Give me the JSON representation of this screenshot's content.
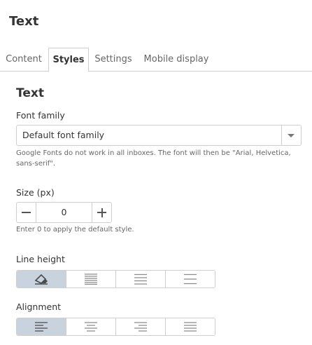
{
  "panel": {
    "title": "Text"
  },
  "tabs": [
    {
      "label": "Content",
      "active": false
    },
    {
      "label": "Styles",
      "active": true
    },
    {
      "label": "Settings",
      "active": false
    },
    {
      "label": "Mobile display",
      "active": false
    }
  ],
  "section": {
    "title": "Text"
  },
  "font_family": {
    "label": "Font family",
    "value": "Default font family",
    "help": "Google Fonts do not work in all inboxes. The font will then be \"Arial, Helvetica, sans-serif\"."
  },
  "size": {
    "label": "Size (px)",
    "value": "0",
    "help": "Enter 0 to apply the default style."
  },
  "line_height": {
    "label": "Line height",
    "options": [
      "eraser-icon",
      "line-height-tight-icon",
      "line-height-normal-icon",
      "line-height-loose-icon"
    ],
    "selected_index": 0
  },
  "alignment": {
    "label": "Alignment",
    "options": [
      "align-left-icon",
      "align-center-icon",
      "align-right-icon",
      "align-justify-icon"
    ],
    "selected_index": 0
  },
  "colors": {
    "selected_segment": "#c9d3de",
    "border": "#cfcfcf",
    "text": "#333333"
  }
}
